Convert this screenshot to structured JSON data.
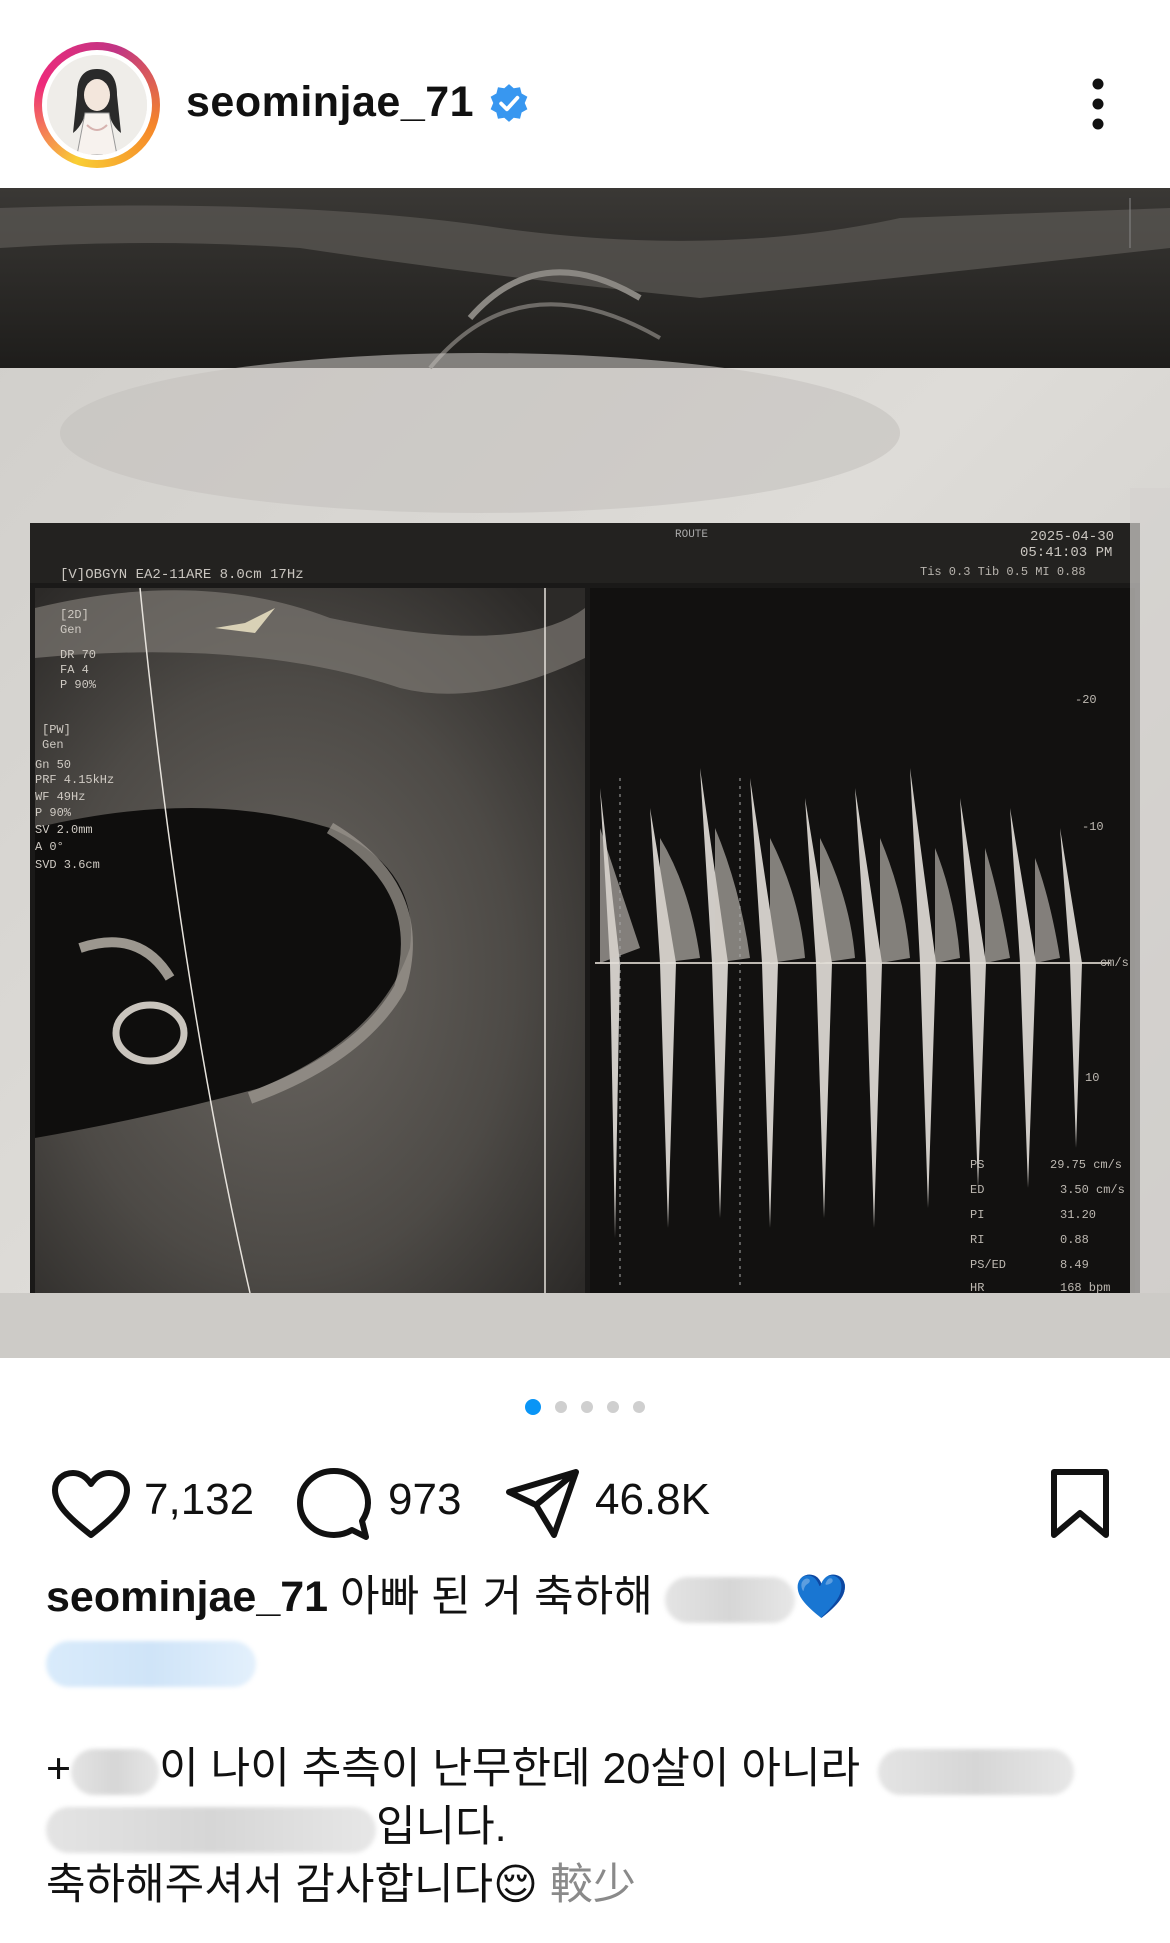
{
  "post": {
    "username": "seominjae_71",
    "image_description": "ultrasound",
    "carousel": {
      "count": 5,
      "active_index": 0
    }
  },
  "actions": {
    "likes": "7,132",
    "comments": "973",
    "shares": "46.8K"
  },
  "caption": {
    "username": "seominjae_71",
    "line1_text": "아빠 된 거 축하해",
    "line1_emoji": "💙",
    "line2_prefix": "+",
    "line2_text": "이 나이 추측이 난무한데 20살이 아니라",
    "line3_text": "입니다.",
    "line4_text": "축하해주셔서 감사합니다😌",
    "more_label": "較少"
  },
  "colors": {
    "accent_blue": "#0a95f6",
    "verified_blue": "#3897f0"
  },
  "icons": [
    "verified-badge-icon",
    "more-options-icon",
    "heart-icon",
    "comment-icon",
    "share-icon",
    "bookmark-icon"
  ]
}
